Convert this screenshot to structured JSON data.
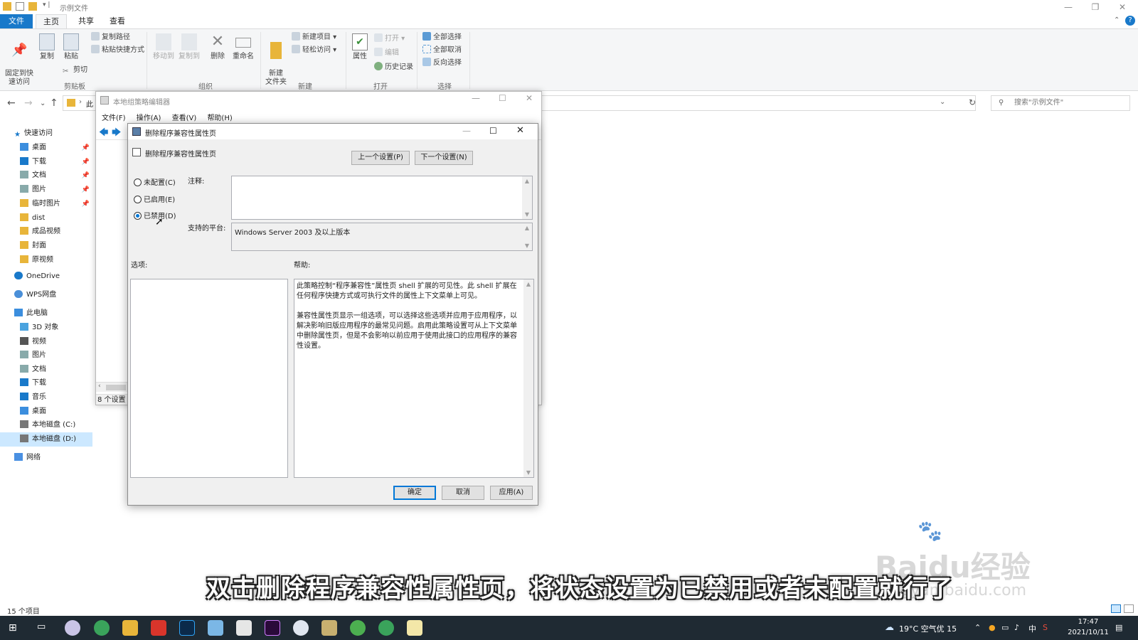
{
  "explorer": {
    "window_title": "示例文件",
    "tabs": {
      "file": "文件",
      "home": "主页",
      "share": "共享",
      "view": "查看"
    },
    "ribbon": {
      "pin": "固定到快\n速访问",
      "copy": "复制",
      "paste": "粘贴",
      "copy_path": "复制路径",
      "paste_shortcut": "粘贴快捷方式",
      "cut": "剪切",
      "clipboard_group": "剪贴板",
      "move_to": "移动到",
      "copy_to": "复制到",
      "delete": "删除",
      "rename": "重命名",
      "organize_group": "组织",
      "new_folder": "新建\n文件夹",
      "new_item": "新建项目",
      "easy_access": "轻松访问",
      "new_group": "新建",
      "properties": "属性",
      "open": "打开",
      "edit": "编辑",
      "history": "历史记录",
      "open_group": "打开",
      "select_all": "全部选择",
      "select_none": "全部取消",
      "invert_selection": "反向选择",
      "select_group": "选择"
    },
    "address_partial": "此",
    "search_placeholder": "搜索\"示例文件\"",
    "nav": {
      "quick_access": "快速访问",
      "quick_items": [
        "桌面",
        "下载",
        "文档",
        "图片",
        "临时图片",
        "dist",
        "成品视频",
        "封面",
        "原视频"
      ],
      "onedrive": "OneDrive",
      "wps": "WPS网盘",
      "this_pc": "此电脑",
      "pc_items": [
        "3D 对象",
        "视频",
        "图片",
        "文档",
        "下载",
        "音乐",
        "桌面",
        "本地磁盘 (C:)",
        "本地磁盘 (D:)"
      ],
      "network": "网络"
    },
    "status_count": "15 个项目"
  },
  "gpedit": {
    "title": "本地组策略编辑器",
    "menu": [
      "文件(F)",
      "操作(A)",
      "查看(V)",
      "帮助(H)"
    ],
    "status": "8 个设置"
  },
  "dialog": {
    "title": "删除程序兼容性属性页",
    "setting_name": "删除程序兼容性属性页",
    "prev_button": "上一个设置(P)",
    "next_button": "下一个设置(N)",
    "radio_not_configured": "未配置(C)",
    "radio_enabled": "已启用(E)",
    "radio_disabled": "已禁用(D)",
    "selected_state": "disabled",
    "comment_label": "注释:",
    "comment_value": "",
    "platform_label": "支持的平台:",
    "platform_value": "Windows Server 2003 及以上版本",
    "options_label": "选项:",
    "help_label": "帮助:",
    "help_text": "此策略控制“程序兼容性”属性页 shell 扩展的可见性。此 shell 扩展在任何程序快捷方式或可执行文件的属性上下文菜单上可见。\n\n兼容性属性页显示一组选项，可以选择这些选项并应用于应用程序，以解决影响旧版应用程序的最常见问题。启用此策略设置可从上下文菜单中删除属性页，但是不会影响以前应用于使用此接口的应用程序的兼容性设置。",
    "ok_button": "确定",
    "cancel_button": "取消",
    "apply_button": "应用(A)"
  },
  "subtitle": "双击删除程序兼容性属性页，将状态设置为已禁用或者未配置就行了",
  "watermark": {
    "brand": "Baidu经验",
    "url": "jingyan.baidu.com"
  },
  "taskbar": {
    "weather": "19°C 空气优 15",
    "ime": "中",
    "time": "17:47",
    "date": "2021/10/11"
  },
  "colors": {
    "accent": "#1979ca",
    "taskbar": "#1f2a33",
    "dialog_bg": "#f0f0f0",
    "selected_nav": "#cce8ff"
  }
}
